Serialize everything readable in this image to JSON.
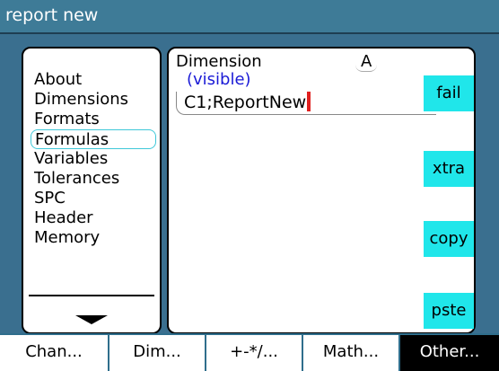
{
  "window": {
    "title": "report new"
  },
  "menu": {
    "items": [
      {
        "label": "About",
        "selected": false
      },
      {
        "label": "Dimensions",
        "selected": false
      },
      {
        "label": "Formats",
        "selected": false
      },
      {
        "label": "Formulas",
        "selected": true
      },
      {
        "label": "Variables",
        "selected": false
      },
      {
        "label": "Tolerances",
        "selected": false
      },
      {
        "label": "SPC",
        "selected": false
      },
      {
        "label": "Header",
        "selected": false
      },
      {
        "label": "Memory",
        "selected": false
      }
    ]
  },
  "editor": {
    "dimension_label": "Dimension",
    "dimension_letter": "A",
    "visible_label": "(visible)",
    "formula_value": "C1;ReportNew"
  },
  "side_buttons": {
    "fail": "fail",
    "xtra": "xtra",
    "copy": "copy",
    "pste": "pste"
  },
  "tabs": [
    {
      "label": "Chan...",
      "active": false
    },
    {
      "label": "Dim...",
      "active": false
    },
    {
      "label": "+-*/...",
      "active": false
    },
    {
      "label": "Math...",
      "active": false
    },
    {
      "label": "Other...",
      "active": true
    }
  ],
  "colors": {
    "title_bg": "#3e7b97",
    "workspace_bg": "#3a6f8f",
    "button_cyan": "#20e6ea",
    "visible_text": "#1a1ad6",
    "cursor": "#e0201f",
    "selection_outline": "#3fc8d9"
  },
  "icons": {
    "scroll_indicator": "triangle-down-icon"
  }
}
